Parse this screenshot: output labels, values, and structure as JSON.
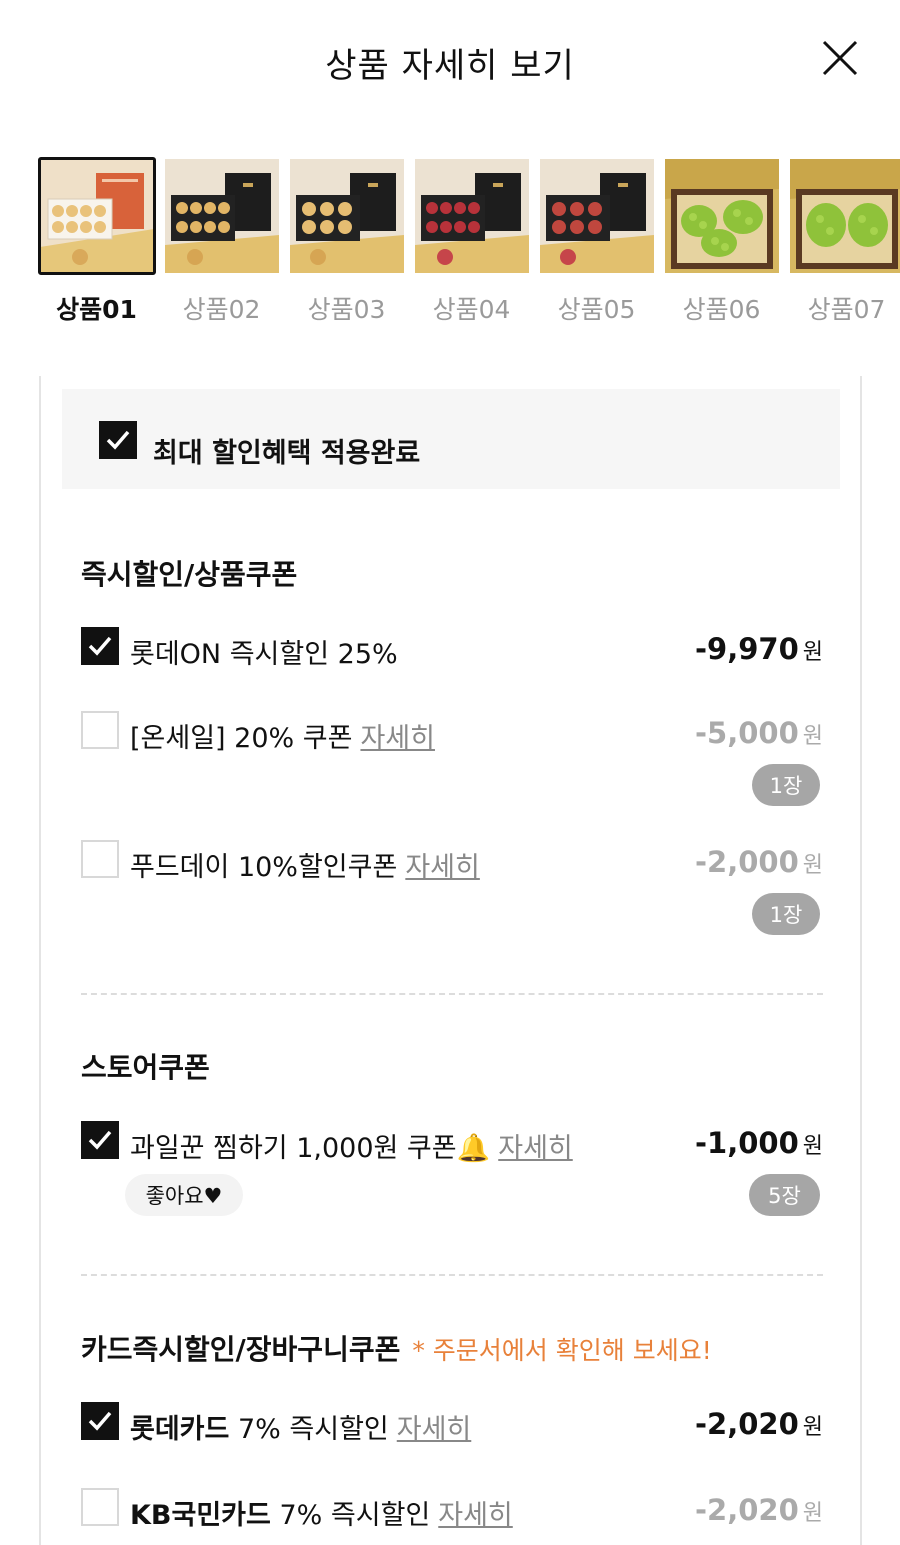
{
  "header": {
    "title": "상품 자세히 보기"
  },
  "thumbnails": [
    {
      "label": "상품01",
      "selected": true,
      "kind": "pear-orange-box"
    },
    {
      "label": "상품02",
      "selected": false,
      "kind": "pear-black-box"
    },
    {
      "label": "상품03",
      "selected": false,
      "kind": "pear-black-box"
    },
    {
      "label": "상품04",
      "selected": false,
      "kind": "apple-black-box"
    },
    {
      "label": "상품05",
      "selected": false,
      "kind": "apple-black-box"
    },
    {
      "label": "상품06",
      "selected": false,
      "kind": "grape-wood-box"
    },
    {
      "label": "상품07",
      "selected": false,
      "kind": "grape-wood-box"
    }
  ],
  "summary": {
    "text": "최대 할인혜택 적용완료",
    "checked": true
  },
  "instant_section": {
    "title": "즉시할인/상품쿠폰",
    "items": [
      {
        "label": "롯데ON 즉시할인 25%",
        "amount": "-9,970",
        "unit": "원",
        "checked": true
      },
      {
        "label": "[온세일] 20% 쿠폰",
        "link": "자세히",
        "amount": "-5,000",
        "unit": "원",
        "checked": false,
        "qty": "1장"
      },
      {
        "label": "푸드데이 10%할인쿠폰",
        "link": "자세히",
        "amount": "-2,000",
        "unit": "원",
        "checked": false,
        "qty": "1장"
      }
    ]
  },
  "store_section": {
    "title": "스토어쿠폰",
    "items": [
      {
        "label": "과일꾼 찜하기 1,000원 쿠폰",
        "emoji": "🔔",
        "link": "자세히",
        "amount": "-1,000",
        "unit": "원",
        "checked": true,
        "qty": "5장",
        "like": "좋아요♥"
      }
    ]
  },
  "card_section": {
    "title": "카드즉시할인/장바구니쿠폰",
    "hint": "* 주문서에서 확인해 보세요!",
    "items": [
      {
        "brand": "롯데카드",
        "label": "7% 즉시할인",
        "link": "자세히",
        "amount": "-2,020",
        "unit": "원",
        "checked": true
      },
      {
        "brand": "KB국민카드",
        "label": "7% 즉시할인",
        "link": "자세히",
        "amount": "-2,020",
        "unit": "원",
        "checked": false
      }
    ]
  },
  "colors": {
    "accent_hint": "#e8813a",
    "check_fill": "#111111",
    "badge": "#a6a6a6",
    "summary_bg": "#f6f6f6"
  }
}
